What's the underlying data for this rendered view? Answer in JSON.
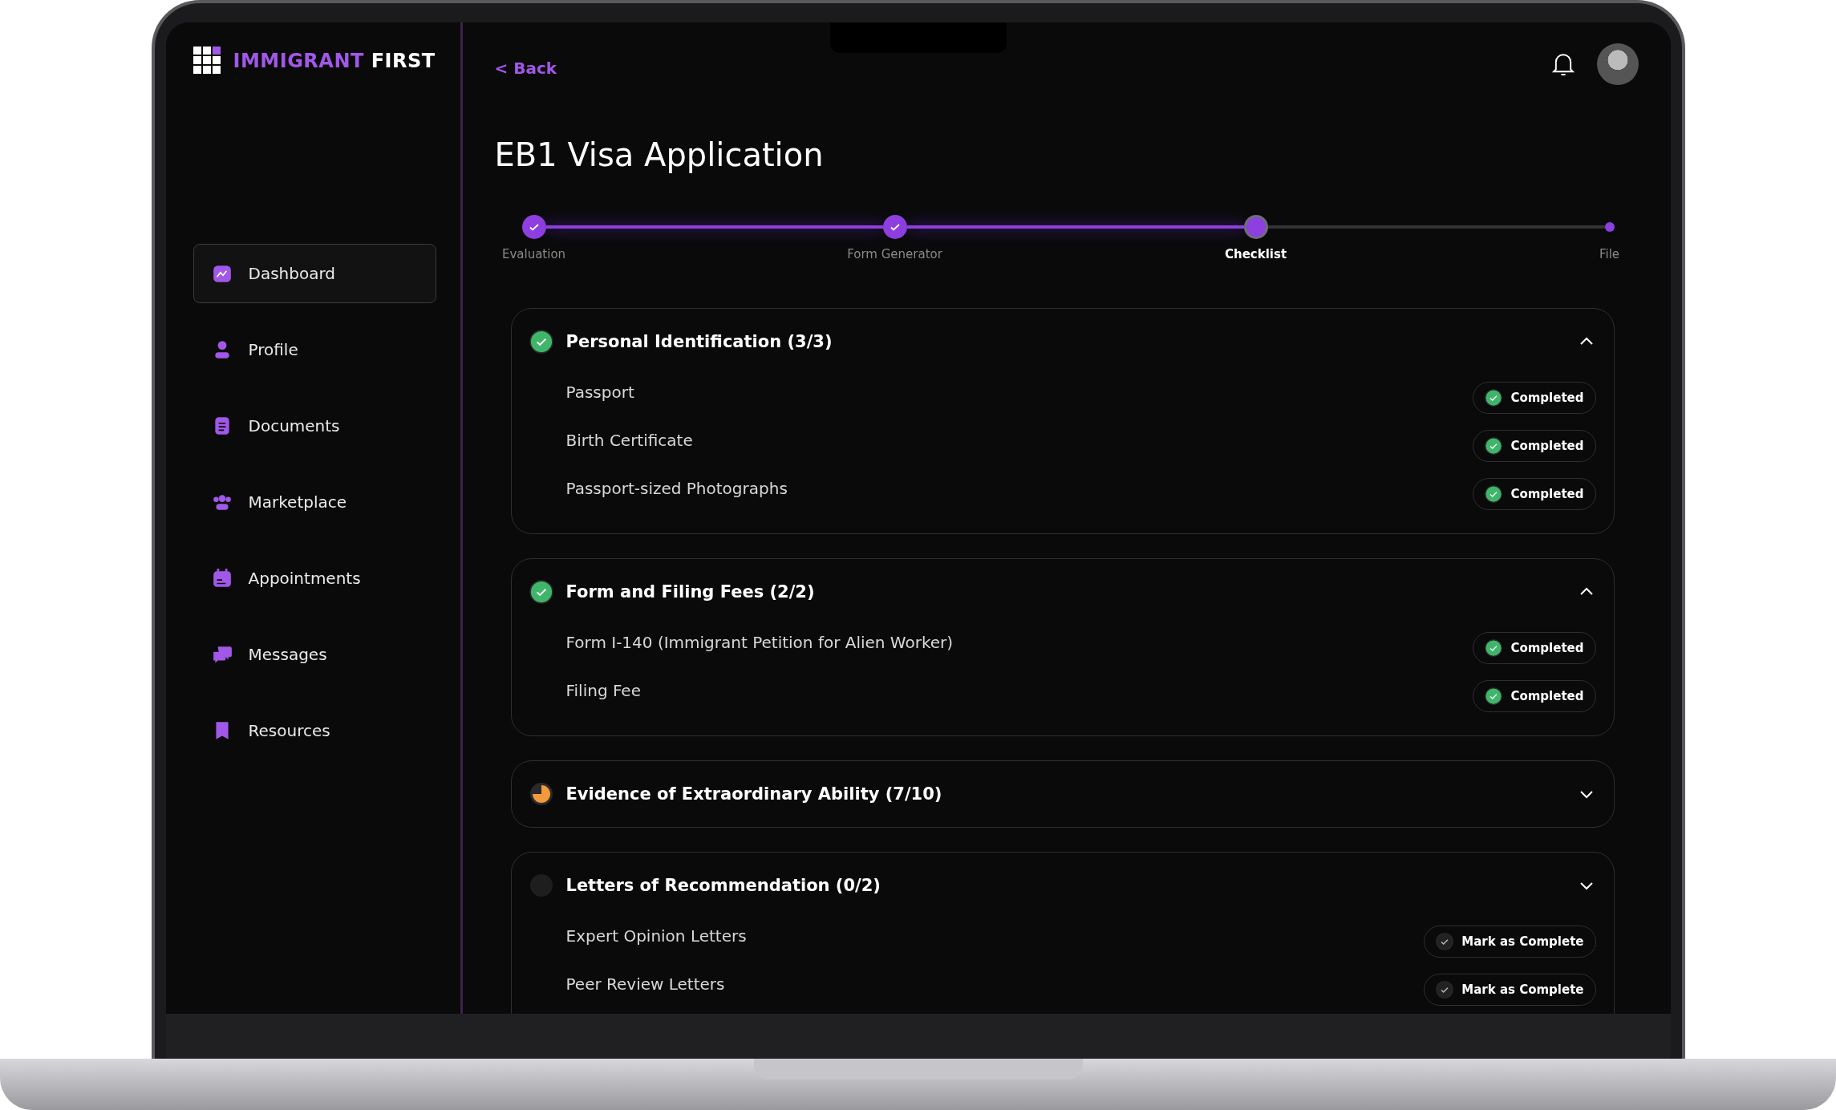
{
  "brand": {
    "first": "IMMIGRANT",
    "second": "FIRST"
  },
  "sidebar": {
    "items": [
      {
        "label": "Dashboard",
        "selected": true
      },
      {
        "label": "Profile",
        "selected": false
      },
      {
        "label": "Documents",
        "selected": false
      },
      {
        "label": "Marketplace",
        "selected": false
      },
      {
        "label": "Appointments",
        "selected": false
      },
      {
        "label": "Messages",
        "selected": false
      },
      {
        "label": "Resources",
        "selected": false
      }
    ]
  },
  "back_link": "< Back",
  "title": "EB1 Visa Application",
  "progress": {
    "steps": [
      {
        "label": "Evaluation",
        "done": true,
        "selected": false
      },
      {
        "label": "Form Generator",
        "done": true,
        "selected": false
      },
      {
        "label": "Checklist",
        "done": false,
        "selected": true
      },
      {
        "label": "File",
        "done": false,
        "selected": false
      }
    ]
  },
  "sections": [
    {
      "title": "Personal Identification (3/3)",
      "kind": "complete",
      "expanded": true,
      "items": [
        {
          "label": "Passport",
          "completed": true,
          "button": "Completed"
        },
        {
          "label": "Birth Certificate",
          "completed": true,
          "button": "Completed"
        },
        {
          "label": "Passport-sized Photographs",
          "completed": true,
          "button": "Completed"
        }
      ]
    },
    {
      "title": "Form and Filing Fees (2/2)",
      "kind": "complete",
      "expanded": true,
      "items": [
        {
          "label": "Form I-140 (Immigrant Petition for Alien Worker)",
          "completed": true,
          "button": "Completed"
        },
        {
          "label": "Filing Fee",
          "completed": true,
          "button": "Completed"
        }
      ]
    },
    {
      "title": "Evidence of Extraordinary Ability (7/10)",
      "kind": "partial",
      "expanded": false
    },
    {
      "title": "Letters of Recommendation (0/2)",
      "kind": "empty",
      "expanded": false,
      "items": [
        {
          "label": "Expert Opinion Letters",
          "completed": false,
          "button": "Mark as Complete"
        },
        {
          "label": "Peer Review Letters",
          "completed": false,
          "button": "Mark as Complete"
        }
      ]
    }
  ]
}
